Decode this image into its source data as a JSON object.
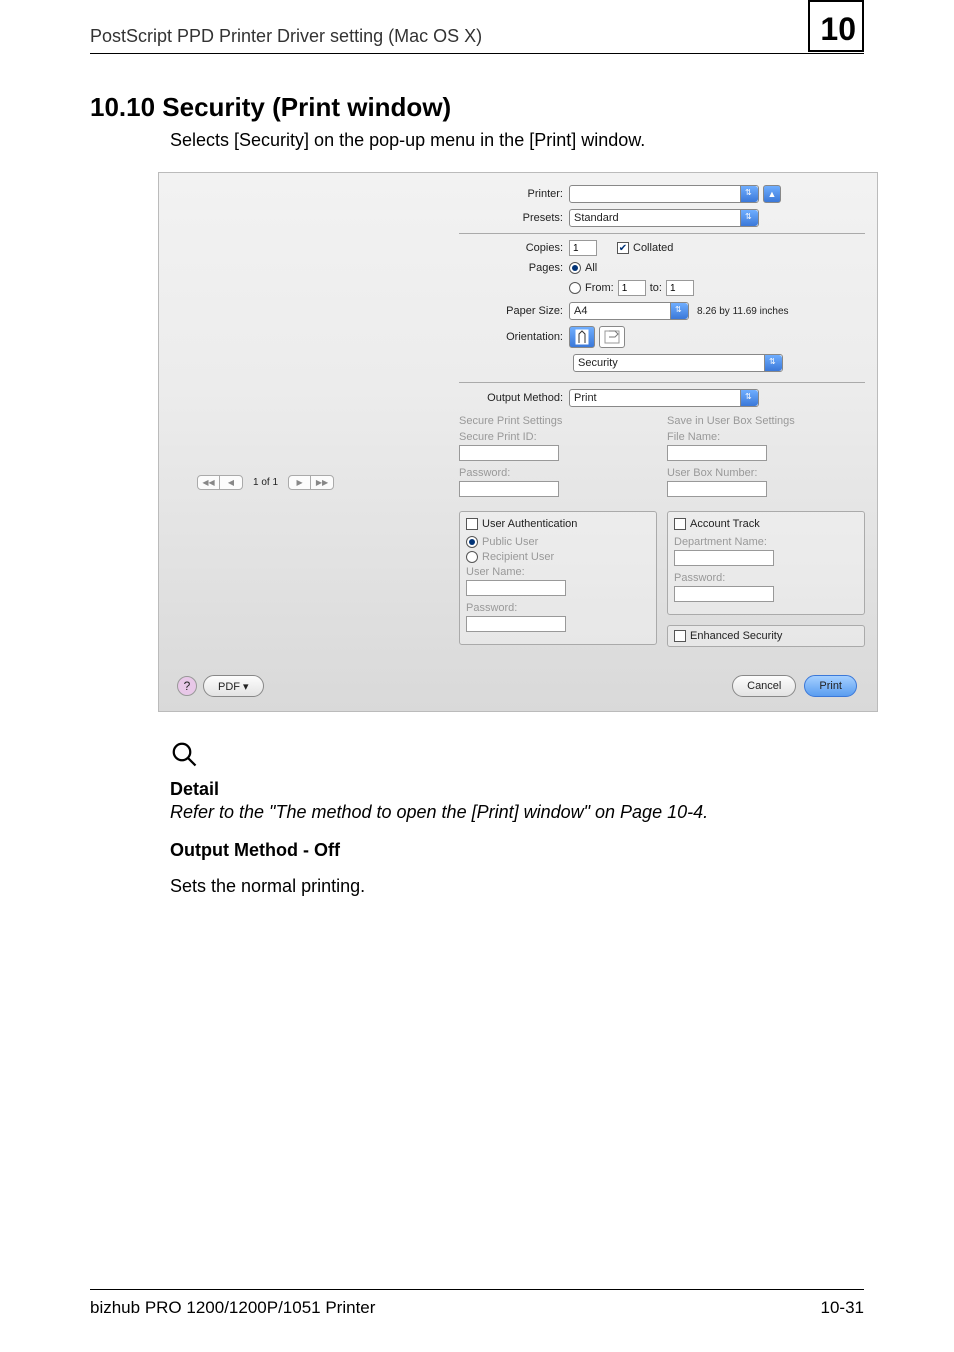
{
  "header": {
    "breadcrumb": "PostScript PPD Printer Driver setting (Mac OS X)",
    "chapter": "10"
  },
  "section": {
    "number_title": "10.10  Security (Print window)",
    "subtitle": "Selects [Security] on the pop-up menu in the [Print] window."
  },
  "dialog": {
    "printer_label": "Printer:",
    "presets_label": "Presets:",
    "presets_value": "Standard",
    "copies_label": "Copies:",
    "copies_value": "1",
    "collated_label": "Collated",
    "pages_label": "Pages:",
    "pages_all": "All",
    "pages_from": "From:",
    "pages_from_value": "1",
    "pages_to": "to:",
    "pages_to_value": "1",
    "papersize_label": "Paper Size:",
    "papersize_value": "A4",
    "papersize_dims": "8.26 by 11.69 inches",
    "orientation_label": "Orientation:",
    "panel_menu_value": "Security",
    "output_method_label": "Output Method:",
    "output_method_value": "Print",
    "secure_settings_title": "Secure Print Settings",
    "secure_print_id_label": "Secure Print ID:",
    "password_label": "Password:",
    "save_box_title": "Save in User Box Settings",
    "file_name_label": "File Name:",
    "user_box_number_label": "User Box Number:",
    "user_auth_title": "User Authentication",
    "public_user": "Public User",
    "recipient_user": "Recipient User",
    "user_name": "User Name:",
    "account_track_title": "Account Track",
    "department_name": "Department Name:",
    "enhanced_security": "Enhanced Security",
    "nav_page": "1 of 1",
    "pdf_button": "PDF ▾",
    "cancel": "Cancel",
    "print": "Print"
  },
  "detail": {
    "heading": "Detail",
    "body": "Refer to the \"The method to open the [Print] window\" on Page 10-4."
  },
  "subsection": {
    "title": "Output Method - Off",
    "body": "Sets the normal printing."
  },
  "footer": {
    "left": "bizhub PRO 1200/1200P/1051 Printer",
    "right": "10-31"
  }
}
